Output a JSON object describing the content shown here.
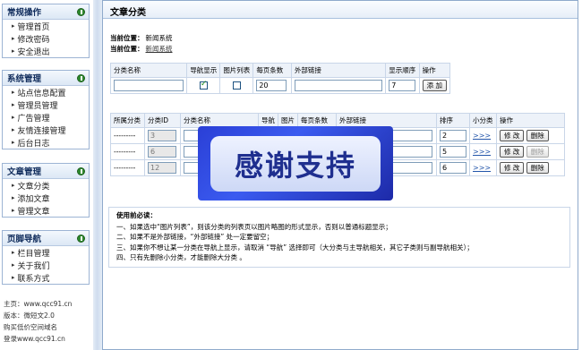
{
  "sidebar": {
    "sections": [
      {
        "title": "常规操作",
        "items": [
          "管理首页",
          "修改密码",
          "安全退出"
        ]
      },
      {
        "title": "系统管理",
        "items": [
          "站点信息配置",
          "管理员管理",
          "广告管理",
          "友情连接管理",
          "后台日志"
        ]
      },
      {
        "title": "文章管理",
        "items": [
          "文章分类",
          "添加文章",
          "管理文章"
        ]
      },
      {
        "title": "页脚导航",
        "items": [
          "栏目管理",
          "关于我们",
          "联系方式"
        ]
      }
    ],
    "footer": [
      "主页：www.qcc91.cn",
      "版本：微短文2.0",
      "购买低价空间域名",
      "登录www.qcc91.cn"
    ]
  },
  "main": {
    "title": "文章分类",
    "location_label": "当前位置：",
    "location_value": "新闻系统",
    "add_table": {
      "headers": [
        "分类名称",
        "导航显示",
        "图片列表",
        "每页条数",
        "外部链接",
        "显示顺序",
        "操作"
      ],
      "row": {
        "name": "",
        "nav_checked": true,
        "img_checked": false,
        "per_page": "20",
        "link": "",
        "order": "7",
        "button": "添 加"
      }
    },
    "list_table": {
      "headers": [
        "所属分类",
        "分类ID",
        "分类名称",
        "导航",
        "图片",
        "每页条数",
        "外部链接",
        "排序",
        "小分类",
        "操作"
      ],
      "rows": [
        {
          "parent": "---------",
          "id": "3",
          "order": "2",
          "sub": ">>>",
          "edit": "修 改",
          "del": "删除",
          "del_disabled": false
        },
        {
          "parent": "---------",
          "id": "6",
          "order": "5",
          "sub": ">>>",
          "edit": "修 改",
          "del": "删除",
          "del_disabled": true
        },
        {
          "parent": "---------",
          "id": "12",
          "order": "6",
          "sub": ">>>",
          "edit": "修 改",
          "del": "删除",
          "del_disabled": false
        }
      ]
    },
    "notes": {
      "title": "使用前必读：",
      "lines": [
        "一、如果选中“图片列表”，则该分类的列表页以图片略图的形式显示，否则以普通标题显示；",
        "二、如果不是外部链接，“外部链接” 处一定要留空；",
        "三、如果你不想让某一分类在导航上显示，请取消 “导航” 选择即可（大分类与主导航相关，其它子类则与副导航相关）；",
        "四、只有先删除小分类，才能删除大分类 。"
      ]
    },
    "watermark": "感谢支持"
  }
}
